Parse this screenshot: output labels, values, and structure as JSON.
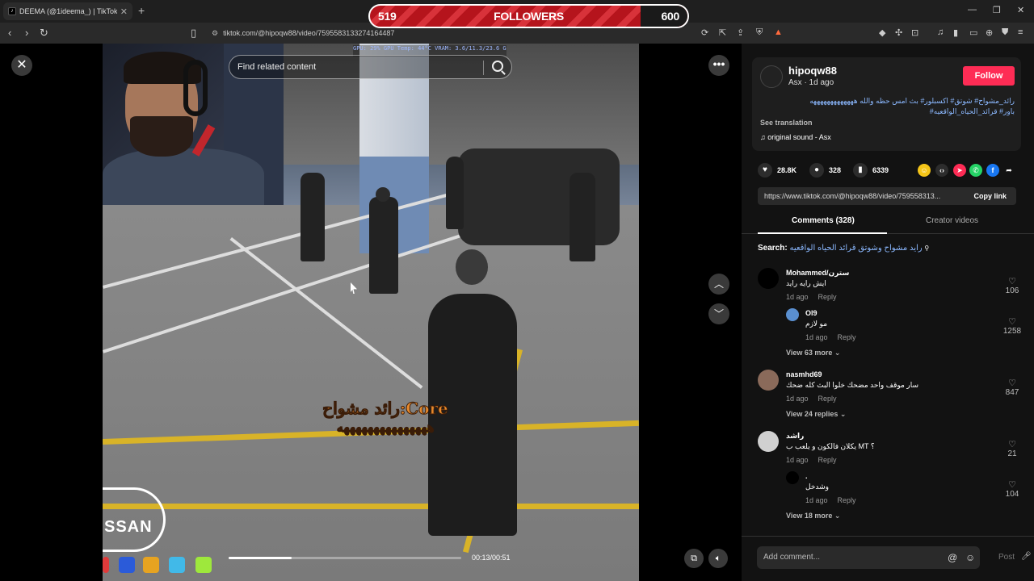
{
  "browser": {
    "tab_title": "DEEMA (@1ideema_) | TikTok",
    "tab_close": "✕",
    "new_tab": "+",
    "url": "tiktok.com/@hipoqw88/video/7595583133274164487"
  },
  "overlay": {
    "left_count": "519",
    "label": "FOLLOWERS",
    "right_count": "600"
  },
  "video": {
    "search_placeholder": "Find related content",
    "close_glyph": "✕",
    "more_glyph": "•••",
    "up_glyph": "︿",
    "down_glyph": "﹀",
    "current_time": "00:13",
    "duration": "00:51",
    "time_text": "00:13/00:51",
    "progress_fraction": 0.27,
    "hud_text": "GPU: 29%   GPU Temp: 44°C  VRAM: 3.6/11.3/23.6 GB",
    "subtitle_line1": "رائد مشواح:Core",
    "subtitle_line2": "هههههههههههههههه",
    "nissan_text": "SSAN"
  },
  "post": {
    "username": "hipoqw88",
    "meta": "Asx · 1d ago",
    "follow_label": "Follow",
    "desc_tags_line1": "رائد_مشواح# شوتق# اكسبلور# بث امس حظه والله هههههههههههههه",
    "desc_tags_line2": "باور# قرائد_الحياه_الواقعيه#",
    "see_translation": "See translation",
    "sound": "original sound - Asx",
    "likes": "28.8K",
    "comments": "328",
    "saves": "6339",
    "link": "https://www.tiktok.com/@hipoqw88/video/759558313...",
    "copy_link": "Copy link"
  },
  "tabs": {
    "comments_label": "Comments (328)",
    "creator_label": "Creator videos"
  },
  "search": {
    "prefix": "Search:",
    "query": "رايد مشواح وشوتق قرائد الحياه الواقعيه"
  },
  "comments": [
    {
      "name": "Mohammed/سترن",
      "text": "ايش رايه رايد",
      "time": "1d ago",
      "reply": "Reply",
      "likes": "106"
    },
    {
      "name": "Ol9",
      "text": "مو لازم",
      "time": "1d ago",
      "reply": "Reply",
      "likes": "1258"
    },
    {
      "name": "nasmhd69",
      "text": "سار موقف واحد مضحك خلوا البث كله ضحك",
      "time": "1d ago",
      "reply": "Reply",
      "likes": "847"
    },
    {
      "name": "راشد",
      "text": "يكلان فالكون و يلعب ب MT ؟",
      "time": "1d ago",
      "reply": "Reply",
      "likes": "21"
    },
    {
      "name": ".",
      "text": "وشدخل",
      "time": "1d ago",
      "reply": "Reply",
      "likes": "104"
    }
  ],
  "view_more": {
    "first": "View 63 more",
    "second": "View 24 replies",
    "third": "View 18 more"
  },
  "add_comment": {
    "placeholder": "Add comment...",
    "post": "Post",
    "at_glyph": "@",
    "emoji_glyph": "☺"
  },
  "colors": {
    "follow": "#fe2c55",
    "overlay_red": "#c41e26",
    "hashtag": "#8bb8ff"
  }
}
